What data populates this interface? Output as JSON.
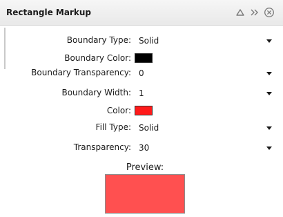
{
  "panel": {
    "title": "Rectangle Markup",
    "icons": {
      "collapse": "triangle-up-icon",
      "expand": "double-chevron-icon",
      "close": "circle-x-icon"
    }
  },
  "fields": {
    "boundary_type": {
      "label": "Boundary Type:",
      "value": "Solid"
    },
    "boundary_color": {
      "label": "Boundary Color:",
      "color": "#000000"
    },
    "boundary_transparency": {
      "label": "Boundary Transparency:",
      "value": "0"
    },
    "boundary_width": {
      "label": "Boundary Width:",
      "value": "1"
    },
    "color": {
      "label": "Color:",
      "color": "#ff1a1a"
    },
    "fill_type": {
      "label": "Fill Type:",
      "value": "Solid"
    },
    "transparency": {
      "label": "Transparency:",
      "value": "30"
    }
  },
  "preview": {
    "label": "Preview:",
    "fill_color": "#ff5050",
    "border_color": "#8c8c8c"
  }
}
